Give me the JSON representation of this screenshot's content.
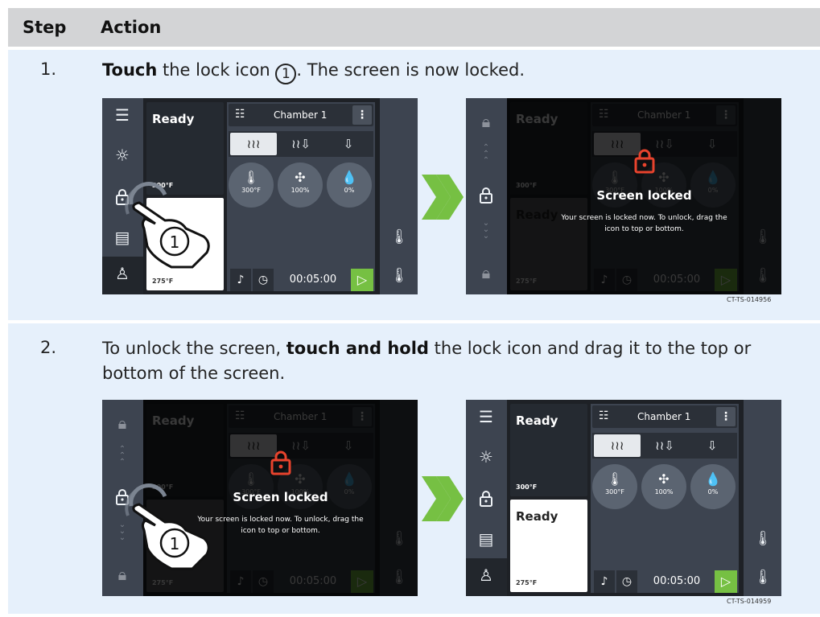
{
  "header": {
    "step": "Step",
    "action": "Action"
  },
  "rows": [
    {
      "num": "1.",
      "instr_bold": "Touch",
      "instr_rest_a": " the lock icon ",
      "instr_marker": "1",
      "instr_rest_b": ". The screen is now locked.",
      "figure_id": "CT-TS-014956"
    },
    {
      "num": "2.",
      "instr_pre": "To unlock the screen, ",
      "instr_bold": "touch and hold",
      "instr_post": " the lock icon and drag it to the top or bottom of the screen.",
      "figure_id": "CT-TS-014959"
    }
  ],
  "screen": {
    "status_top": "Ready",
    "status_bottom": "Ready",
    "temp_top": "300°F",
    "temp_bottom": "275°F",
    "chamber": "Chamber 1",
    "dial_temp": "300°F",
    "dial_fan": "100%",
    "dial_humidity": "0%",
    "timer": "00:05:00"
  },
  "lock_overlay": {
    "title": "Screen locked",
    "message_line1": "Your screen is locked now. To unlock, drag the",
    "message_line2": "icon to top or bottom."
  },
  "callout_marker": "1",
  "colors": {
    "accent_green": "#76c043",
    "lock_red": "#e8432d",
    "header_gray": "#d3d4d6",
    "row_blue": "#e6f0fb"
  }
}
